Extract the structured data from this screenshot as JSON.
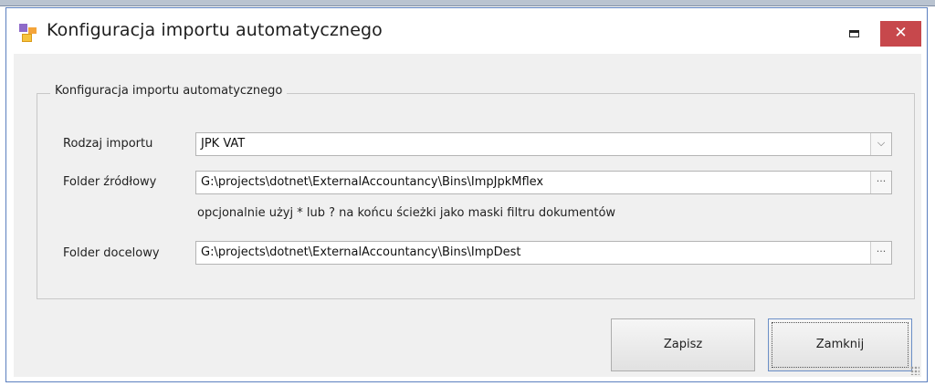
{
  "window": {
    "title": "Konfiguracja importu automatycznego",
    "close_glyph": "✕"
  },
  "form": {
    "group_title": "Konfiguracja importu automatycznego",
    "import_type": {
      "label": "Rodzaj importu",
      "value": "JPK VAT"
    },
    "source_folder": {
      "label": "Folder źródłowy",
      "value": "G:\\projects\\dotnet\\ExternalAccountancy\\Bins\\ImpJpkMflex"
    },
    "hint": "opcjonalnie użyj * lub ? na końcu ścieżki jako maski filtru dokumentów",
    "target_folder": {
      "label": "Folder docelowy",
      "value": "G:\\projects\\dotnet\\ExternalAccountancy\\Bins\\ImpDest"
    },
    "browse_glyph": "···",
    "dropdown_glyph": "⌵"
  },
  "buttons": {
    "save": "Zapisz",
    "close": "Zamknij"
  },
  "colors": {
    "close_button": "#c7484c",
    "client_background": "#f0f0f0",
    "window_border": "#5b7fbf"
  }
}
